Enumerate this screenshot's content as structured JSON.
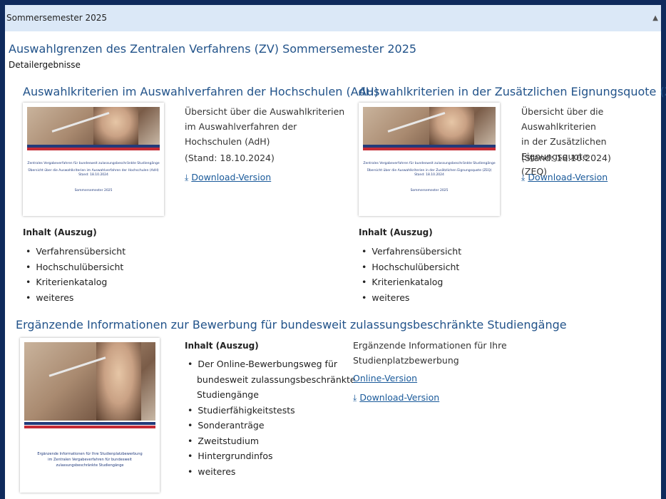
{
  "semester_bar": {
    "label": "Sommersemester 2025"
  },
  "main": {
    "title": "Auswahlgrenzen des Zentralen Verfahrens (ZV) Sommersemester 2025",
    "subtitle": "Detailergebnisse"
  },
  "adh": {
    "heading": "Auswahlkriterien im Auswahlverfahren der Hochschulen (AdH)",
    "desc_lines": [
      "Übersicht über die Auswahlkriterien",
      "im Auswahlverfahren der",
      "Hochschulen (AdH)"
    ],
    "stand": "(Stand: 18.10.2024)",
    "download": "Download-Version",
    "inhalt_label": "Inhalt (Auszug)",
    "items": [
      "Verfahrensübersicht",
      "Hochschulübersicht",
      "Kriterienkatalog",
      "weiteres"
    ],
    "doc_caption": [
      "Zentrales Vergabeverfahren für bundesweit zulassungsbeschränkte Studiengänge",
      "Übersicht über die Auswahlkriterien im Auswahlverfahren der Hochschulen (AdH)",
      "Stand: 18.10.2024"
    ],
    "doc_footer": "Sommersemester 2025"
  },
  "zeq": {
    "heading": "Auswahlkriterien in der Zusätzlichen Eignungsquote (ZEQ)",
    "desc_lines": [
      "Übersicht über die Auswahlkriterien",
      "in der Zusätzlichen Eignungsquote",
      "(ZEQ)"
    ],
    "stand": "(Stand: 18.10.2024)",
    "download": "Download-Version",
    "inhalt_label": "Inhalt (Auszug)",
    "items": [
      "Verfahrensübersicht",
      "Hochschulübersicht",
      "Kriterienkatalog",
      "weiteres"
    ],
    "doc_caption": [
      "Zentrales Vergabeverfahren für bundesweit zulassungsbeschränkte Studiengänge",
      "Übersicht über die Auswahlkriterien in der Zusätzlichen Eignungsquote (ZEQ)",
      "Stand: 18.10.2024"
    ],
    "doc_footer": "Sommersemester 2025"
  },
  "erg": {
    "heading": "Ergänzende Informationen zur Bewerbung für bundesweit zulassungsbeschränkte Studiengänge",
    "inhalt_label": "Inhalt (Auszug)",
    "items": [
      "Der Online-Bewerbungsweg für",
      "bundesweit zulassungsbeschränkte",
      "Studiengänge",
      "Studierfähigkeitstests",
      "Sonderanträge",
      "Zweitstudium",
      "Hintergrundinfos",
      "weiteres"
    ],
    "desc_lines": [
      "Ergänzende Informationen für Ihre",
      "Studienplatzbewerbung"
    ],
    "online": "Online-Version",
    "download": "Download-Version",
    "doc_caption": [
      "Ergänzende Informationen für Ihre Studienplatzbewerbung",
      "im Zentralen Vergabeverfahren für bundesweit",
      "zulassungsbeschränkte Studiengänge"
    ]
  },
  "icons": {
    "download": "download-icon"
  }
}
